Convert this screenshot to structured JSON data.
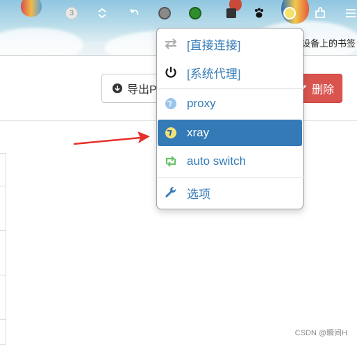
{
  "toolbar": {
    "badge_count": "3",
    "bookmark_text": "设备上的书签"
  },
  "page": {
    "export_label": "导出P",
    "delete_label": "删除"
  },
  "menu": {
    "items": [
      {
        "label": "[直接连接]",
        "icon": "swap-arrows-icon"
      },
      {
        "label": "[系统代理]",
        "icon": "power-icon"
      },
      {
        "label": "proxy",
        "icon": "globe-icon"
      },
      {
        "label": "xray",
        "icon": "globe-icon",
        "active": true
      },
      {
        "label": "auto switch",
        "icon": "retweet-icon"
      },
      {
        "label": "选项",
        "icon": "wrench-icon"
      }
    ]
  },
  "colors": {
    "accent": "#337ab7",
    "danger": "#d9534f",
    "arrow": "#e8302a"
  },
  "watermark": "CSDN @瞬间H"
}
